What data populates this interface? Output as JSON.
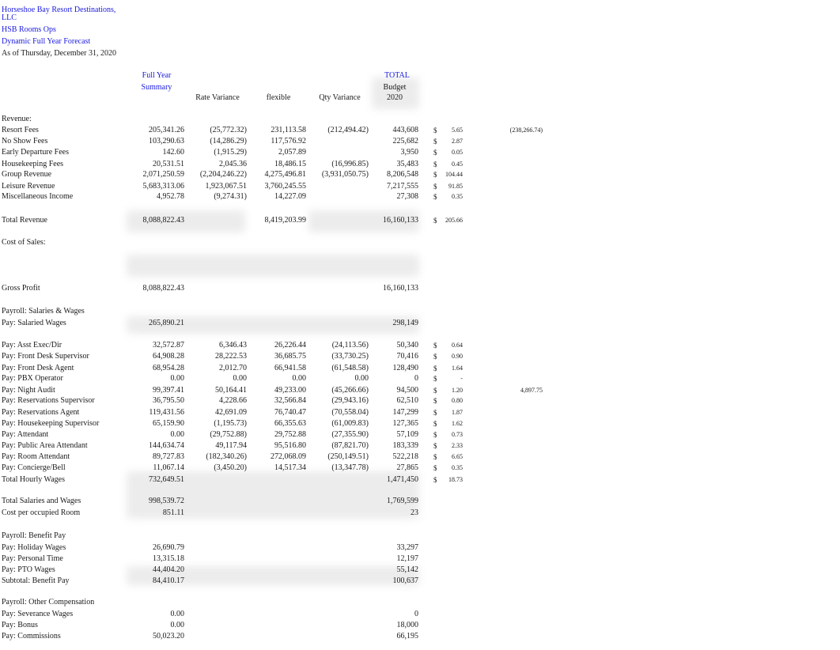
{
  "header": {
    "company_line1": "Horseshoe Bay Resort Destinations,",
    "company_line2": "LLC",
    "department": "HSB Rooms Ops",
    "report": "Dynamic Full Year Forecast",
    "as_of": "As of Thursday, December 31, 2020"
  },
  "columns": {
    "full_year_1": "Full Year",
    "full_year_2": "Summary",
    "rate_variance": "Rate Variance",
    "flexible": "flexible",
    "qty_variance": "Qty Variance",
    "total": "TOTAL",
    "budget": "Budget",
    "budget_year": "2020"
  },
  "currency_symbol": "$",
  "rows": [
    {
      "label": "Revenue:",
      "type": "section"
    },
    {
      "label": "Resort Fees",
      "full_year": "205,341.26",
      "rate_var": "(25,772.32)",
      "flexible": "231,113.58",
      "qty_var": "(212,494.42)",
      "budget": "443,608",
      "per_room": "5.65",
      "extra": "(238,266.74)"
    },
    {
      "label": "No Show Fees",
      "full_year": "103,290.63",
      "rate_var": "(14,286.29)",
      "flexible": "117,576.92",
      "qty_var": "",
      "budget": "225,682",
      "per_room": "2.87"
    },
    {
      "label": "Early Departure Fees",
      "full_year": "142.60",
      "rate_var": "(1,915.29)",
      "flexible": "2,057.89",
      "qty_var": "",
      "budget": "3,950",
      "per_room": "0.05"
    },
    {
      "label": "Housekeeping Fees",
      "full_year": "20,531.51",
      "rate_var": "2,045.36",
      "flexible": "18,486.15",
      "qty_var": "(16,996.85)",
      "budget": "35,483",
      "per_room": "0.45"
    },
    {
      "label": "Group Revenue",
      "full_year": "2,071,250.59",
      "rate_var": "(2,204,246.22)",
      "flexible": "4,275,496.81",
      "qty_var": "(3,931,050.75)",
      "budget": "8,206,548",
      "per_room": "104.44"
    },
    {
      "label": "Leisure Revenue",
      "full_year": "5,683,313.06",
      "rate_var": "1,923,067.51",
      "flexible": "3,760,245.55",
      "qty_var": "",
      "budget": "7,217,555",
      "per_room": "91.85"
    },
    {
      "label": "Miscellaneous Income",
      "full_year": "4,952.78",
      "rate_var": "(9,274.31)",
      "flexible": "14,227.09",
      "qty_var": "",
      "budget": "27,308",
      "per_room": "0.35"
    },
    {
      "label": "Total Revenue",
      "full_year": "8,088,822.43",
      "rate_var": "",
      "flexible": "8,419,203.99",
      "qty_var": "",
      "budget": "16,160,133",
      "per_room": "205.66"
    },
    {
      "label": "Cost of Sales:",
      "type": "section"
    },
    {
      "label": "Gross Profit",
      "full_year": "8,088,822.43",
      "budget": "16,160,133"
    },
    {
      "label": "Payroll:  Salaries & Wages",
      "type": "section"
    },
    {
      "label": "Pay: Salaried Wages",
      "full_year": "265,890.21",
      "budget": "298,149"
    },
    {
      "label": "Pay: Asst Exec/Dir",
      "full_year": "32,572.87",
      "rate_var": "6,346.43",
      "flexible": "26,226.44",
      "qty_var": "(24,113.56)",
      "budget": "50,340",
      "per_room": "0.64"
    },
    {
      "label": "Pay: Front Desk Supervisor",
      "full_year": "64,908.28",
      "rate_var": "28,222.53",
      "flexible": "36,685.75",
      "qty_var": "(33,730.25)",
      "budget": "70,416",
      "per_room": "0.90"
    },
    {
      "label": "Pay: Front Desk Agent",
      "full_year": "68,954.28",
      "rate_var": "2,012.70",
      "flexible": "66,941.58",
      "qty_var": "(61,548.58)",
      "budget": "128,490",
      "per_room": "1.64"
    },
    {
      "label": "Pay: PBX Operator",
      "full_year": "0.00",
      "rate_var": "0.00",
      "flexible": "0.00",
      "qty_var": "0.00",
      "budget": "0",
      "per_room": "-"
    },
    {
      "label": "Pay: Night Audit",
      "full_year": "99,397.41",
      "rate_var": "50,164.41",
      "flexible": "49,233.00",
      "qty_var": "(45,266.66)",
      "budget": "94,500",
      "per_room": "1.20",
      "extra": "4,897.75"
    },
    {
      "label": "Pay: Reservations Supervisor",
      "full_year": "36,795.50",
      "rate_var": "4,228.66",
      "flexible": "32,566.84",
      "qty_var": "(29,943.16)",
      "budget": "62,510",
      "per_room": "0.80"
    },
    {
      "label": "Pay: Reservations Agent",
      "full_year": "119,431.56",
      "rate_var": "42,691.09",
      "flexible": "76,740.47",
      "qty_var": "(70,558.04)",
      "budget": "147,299",
      "per_room": "1.87"
    },
    {
      "label": "Pay: Housekeeping Supervisor",
      "full_year": "65,159.90",
      "rate_var": "(1,195.73)",
      "flexible": "66,355.63",
      "qty_var": "(61,009.83)",
      "budget": "127,365",
      "per_room": "1.62"
    },
    {
      "label": "Pay: Attendant",
      "full_year": "0.00",
      "rate_var": "(29,752.88)",
      "flexible": "29,752.88",
      "qty_var": "(27,355.90)",
      "budget": "57,109",
      "per_room": "0.73"
    },
    {
      "label": "Pay: Public Area Attendant",
      "full_year": "144,634.74",
      "rate_var": "49,117.94",
      "flexible": "95,516.80",
      "qty_var": "(87,821.70)",
      "budget": "183,339",
      "per_room": "2.33"
    },
    {
      "label": "Pay: Room Attendant",
      "full_year": "89,727.83",
      "rate_var": "(182,340.26)",
      "flexible": "272,068.09",
      "qty_var": "(250,149.51)",
      "budget": "522,218",
      "per_room": "6.65"
    },
    {
      "label": "Pay: Concierge/Bell",
      "full_year": "11,067.14",
      "rate_var": "(3,450.20)",
      "flexible": "14,517.34",
      "qty_var": "(13,347.78)",
      "budget": "27,865",
      "per_room": "0.35"
    },
    {
      "label": "Total Hourly Wages",
      "full_year": "732,649.51",
      "budget": "1,471,450",
      "per_room": "18.73"
    },
    {
      "label": "Total Salaries and Wages",
      "full_year": "998,539.72",
      "budget": "1,769,599"
    },
    {
      "label": "Cost per occupied Room",
      "full_year": "851.11",
      "budget": "23"
    },
    {
      "label": "Payroll:  Benefit Pay",
      "type": "section"
    },
    {
      "label": "Pay: Holiday Wages",
      "full_year": "26,690.79",
      "budget": "33,297"
    },
    {
      "label": "Pay: Personal Time",
      "full_year": "13,315.18",
      "budget": "12,197"
    },
    {
      "label": "Pay: PTO Wages",
      "full_year": "44,404.20",
      "budget": "55,142"
    },
    {
      "label": "Subtotal:  Benefit Pay",
      "full_year": "84,410.17",
      "budget": "100,637"
    },
    {
      "label": "Payroll:  Other Compensation",
      "type": "section"
    },
    {
      "label": "Pay: Severance Wages",
      "full_year": "0.00",
      "budget": "0"
    },
    {
      "label": "Pay: Bonus",
      "full_year": "0.00",
      "budget": "18,000"
    },
    {
      "label": "Pay: Commissions",
      "full_year": "50,023.20",
      "budget": "66,195"
    }
  ]
}
